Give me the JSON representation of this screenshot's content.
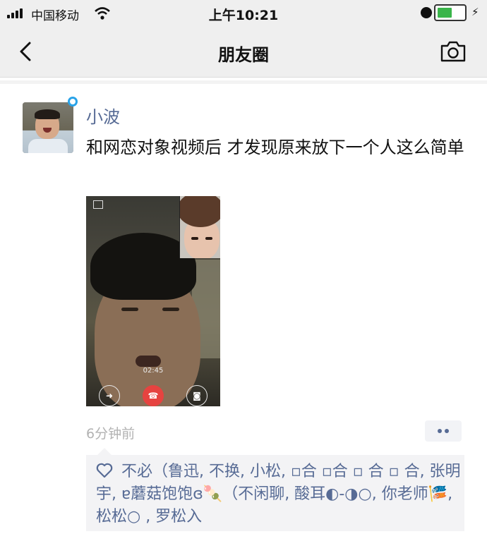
{
  "status_bar": {
    "carrier": "中国移动",
    "time": "上午10:21"
  },
  "nav": {
    "title": "朋友圈",
    "back_icon": "chevron-left-icon",
    "camera_icon": "camera-icon"
  },
  "post": {
    "username": "小波",
    "text": "和网恋对象视频后 才发现原来放下一个人这么简单",
    "video_duration": "02:45",
    "time_ago": "6分钟前",
    "likes_text": "不必（鲁迅, 不换, 小松, ▫合 ▫合 ▫ 合 ▫ 合, 张明宇, ɐ蘑菇饱饱ɞ🍡（不闲聊, 酸耳◐-◑○, 你老师🎏, 松松○ , 罗松入"
  },
  "colors": {
    "link": "#576b95",
    "bar_bg": "#efefef",
    "hangup": "#e64340"
  }
}
